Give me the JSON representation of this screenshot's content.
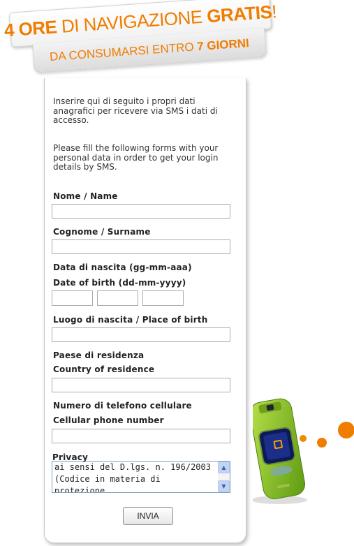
{
  "banner": {
    "line1_part1": "4 ORE",
    "line1_part2": "DI NAVIGAZIONE",
    "line1_part3": "GRATIS",
    "line1_part4": "!",
    "line2_part1": "DA CONSUMARSI ENTRO",
    "line2_part2": "7 GIORNI"
  },
  "intro": {
    "italian": "Inserire qui di seguito i propri dati anagrafici per ricevere via SMS i dati di accesso.",
    "english": "Please fill the following forms with your personal data in order to get your login details by SMS."
  },
  "form": {
    "name_label": "Nome / Name",
    "name_value": "",
    "surname_label": "Cognome / Surname",
    "surname_value": "",
    "dob_label_it": "Data di nascita (gg-mm-aaa)",
    "dob_label_en": "Date of birth (dd-mm-yyyy)",
    "dob_day": "",
    "dob_month": "",
    "dob_year": "",
    "birthplace_label": "Luogo di nascita / Place of birth",
    "birthplace_value": "",
    "country_label_it": "Paese di residenza",
    "country_label_en": "Country of residence",
    "country_value": "",
    "phone_label_it": "Numero di telefono cellulare",
    "phone_label_en": "Cellular phone number",
    "phone_value": "",
    "privacy_label": "Privacy",
    "privacy_text": "ai sensi del D.lgs. n. 196/2003 (Codice in materia di protezione",
    "submit_label": "INVIA"
  },
  "colors": {
    "accent": "#f07c00",
    "phone_body": "#8dc21f",
    "screen": "#1a2e8a"
  },
  "icons": {
    "scroll_up": "scroll-up-arrow-icon",
    "scroll_down": "scroll-down-arrow-icon",
    "phone": "mobile-phone-illustration"
  }
}
